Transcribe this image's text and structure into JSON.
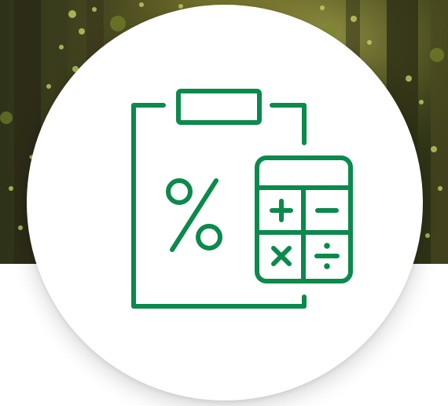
{
  "banner": {
    "image": "forest-sunlight-photo"
  },
  "badge": {
    "icon": "tax-clipboard-calculator-icon",
    "accent_color": "#0b8a4c",
    "glyphs": {
      "percent": "%",
      "plus": "+",
      "minus": "−",
      "times": "×",
      "divide": "÷"
    }
  }
}
